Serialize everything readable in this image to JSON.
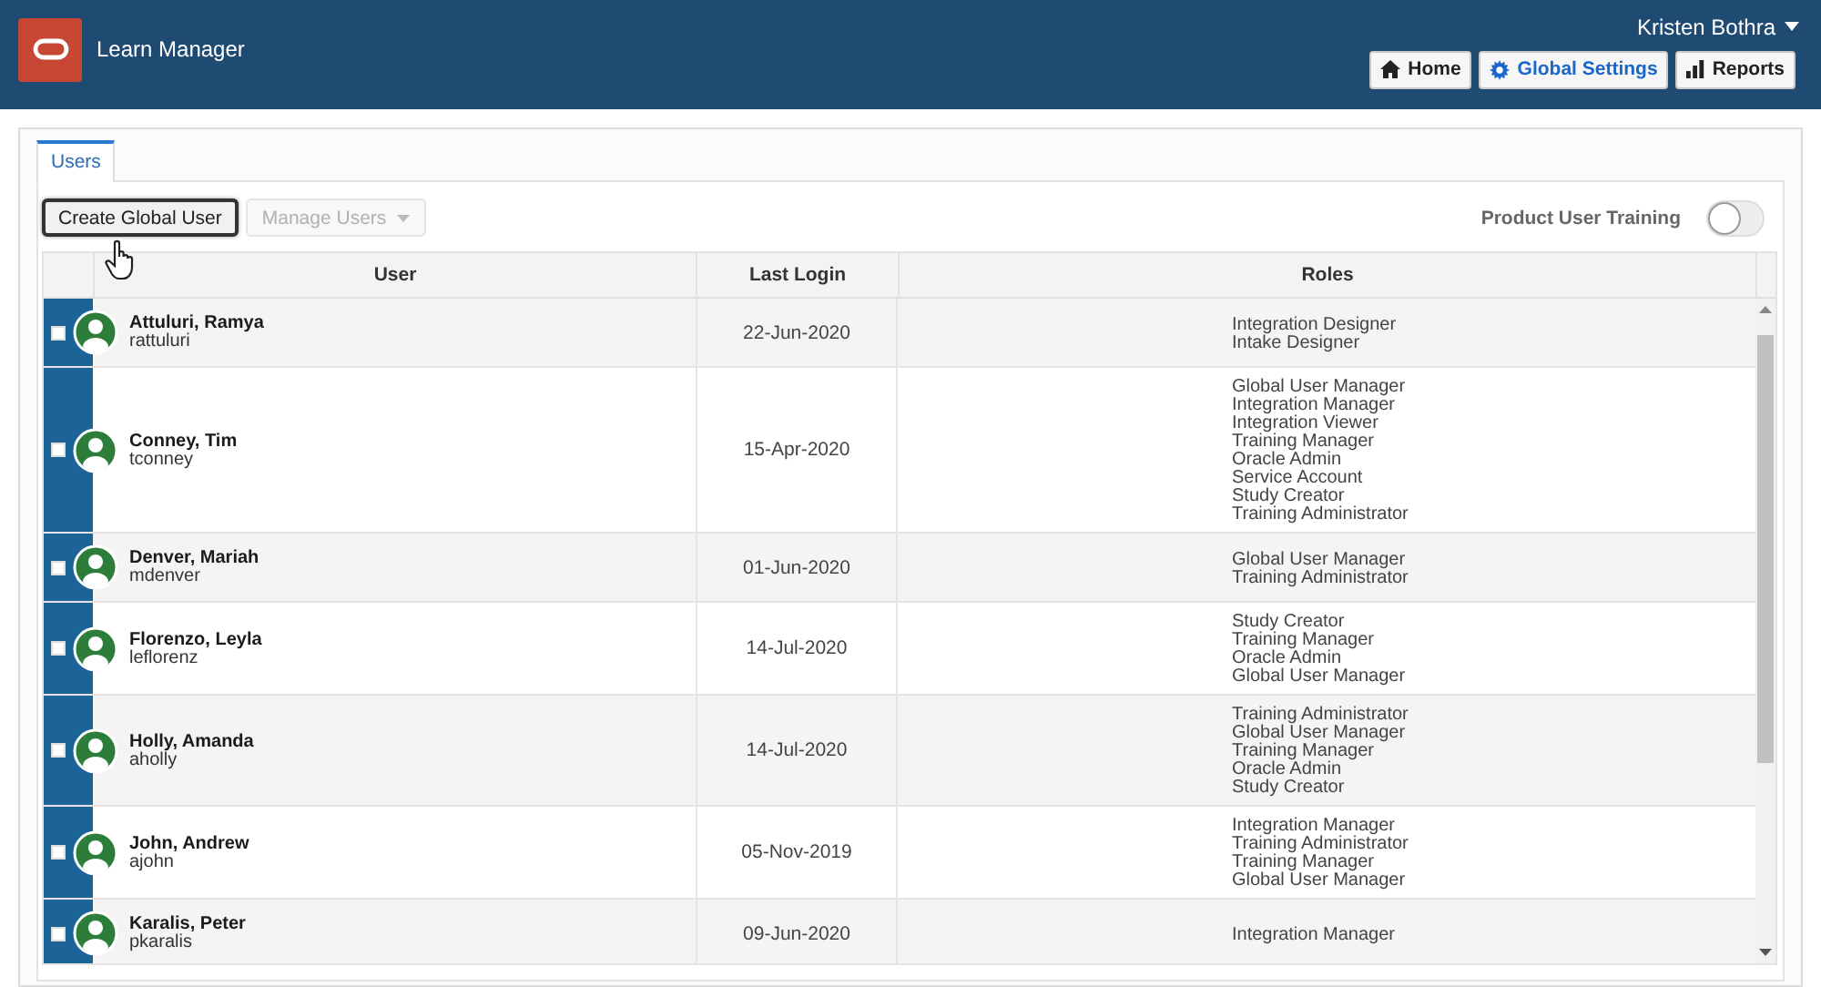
{
  "header": {
    "app_title": "Learn Manager",
    "user_name": "Kristen Bothra",
    "nav_buttons": [
      {
        "label": "Home",
        "kind": "home",
        "selected": false
      },
      {
        "label": "Global Settings",
        "kind": "settings",
        "selected": true
      },
      {
        "label": "Reports",
        "kind": "reports",
        "selected": false
      }
    ]
  },
  "tabs": [
    {
      "label": "Users",
      "selected": true
    }
  ],
  "toolbar": {
    "buttons": [
      {
        "label": "Create Global User",
        "kind": "button",
        "disabled": false
      },
      {
        "label": "Manage Users",
        "kind": "menu",
        "disabled": true
      }
    ],
    "toggle": {
      "label": "Product User Training",
      "on": false
    }
  },
  "table": {
    "columns": [
      "User",
      "Last Login",
      "Roles"
    ],
    "rows": [
      {
        "name": "Attuluri, Ramya",
        "username": "rattuluri",
        "last_login": "22-Jun-2020",
        "roles": [
          "Integration Designer",
          "Intake Designer"
        ],
        "checked": false
      },
      {
        "name": "Conney, Tim",
        "username": "tconney",
        "last_login": "15-Apr-2020",
        "roles": [
          "Global User Manager",
          "Integration Manager",
          "Integration Viewer",
          "Training Manager",
          "Oracle Admin",
          "Service Account",
          "Study Creator",
          "Training Administrator"
        ],
        "checked": false
      },
      {
        "name": "Denver, Mariah",
        "username": "mdenver",
        "last_login": "01-Jun-2020",
        "roles": [
          "Global User Manager",
          "Training Administrator"
        ],
        "checked": false
      },
      {
        "name": "Florenzo, Leyla",
        "username": "leflorenz",
        "last_login": "14-Jul-2020",
        "roles": [
          "Study Creator",
          "Training Manager",
          "Oracle Admin",
          "Global User Manager"
        ],
        "checked": false
      },
      {
        "name": "Holly, Amanda",
        "username": "aholly",
        "last_login": "14-Jul-2020",
        "roles": [
          "Training Administrator",
          "Global User Manager",
          "Training Manager",
          "Oracle Admin",
          "Study Creator"
        ],
        "checked": false
      },
      {
        "name": "John, Andrew",
        "username": "ajohn",
        "last_login": "05-Nov-2019",
        "roles": [
          "Integration Manager",
          "Training Administrator",
          "Training Manager",
          "Global User Manager"
        ],
        "checked": false
      },
      {
        "name": "Karalis, Peter",
        "username": "pkaralis",
        "last_login": "09-Jun-2020",
        "roles": [
          "Integration Manager"
        ],
        "checked": false
      }
    ]
  }
}
